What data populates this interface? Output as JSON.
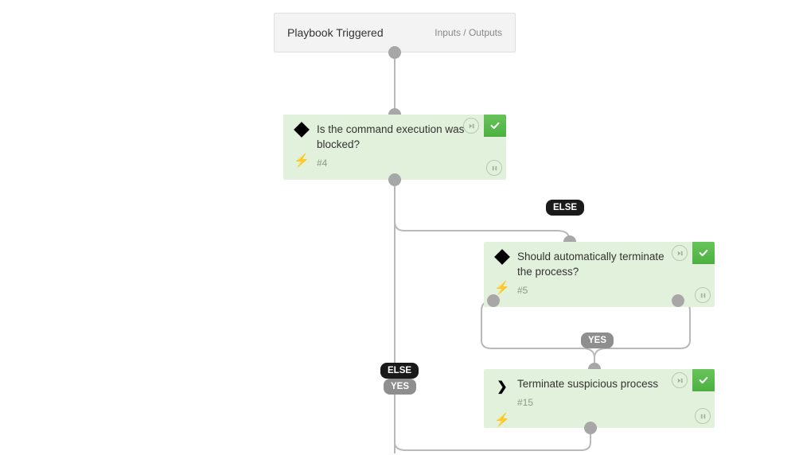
{
  "trigger": {
    "title": "Playbook Triggered",
    "sub": "Inputs / Outputs"
  },
  "steps": [
    {
      "question": "Is the command execution was blocked?",
      "num": "#4",
      "iconType": "diamond"
    },
    {
      "question": "Should automatically terminate the process?",
      "num": "#5",
      "iconType": "diamond"
    },
    {
      "question": "Terminate suspicious process",
      "num": "#15",
      "iconType": "chevron"
    }
  ],
  "labels": {
    "else": "ELSE",
    "yes": "YES"
  }
}
